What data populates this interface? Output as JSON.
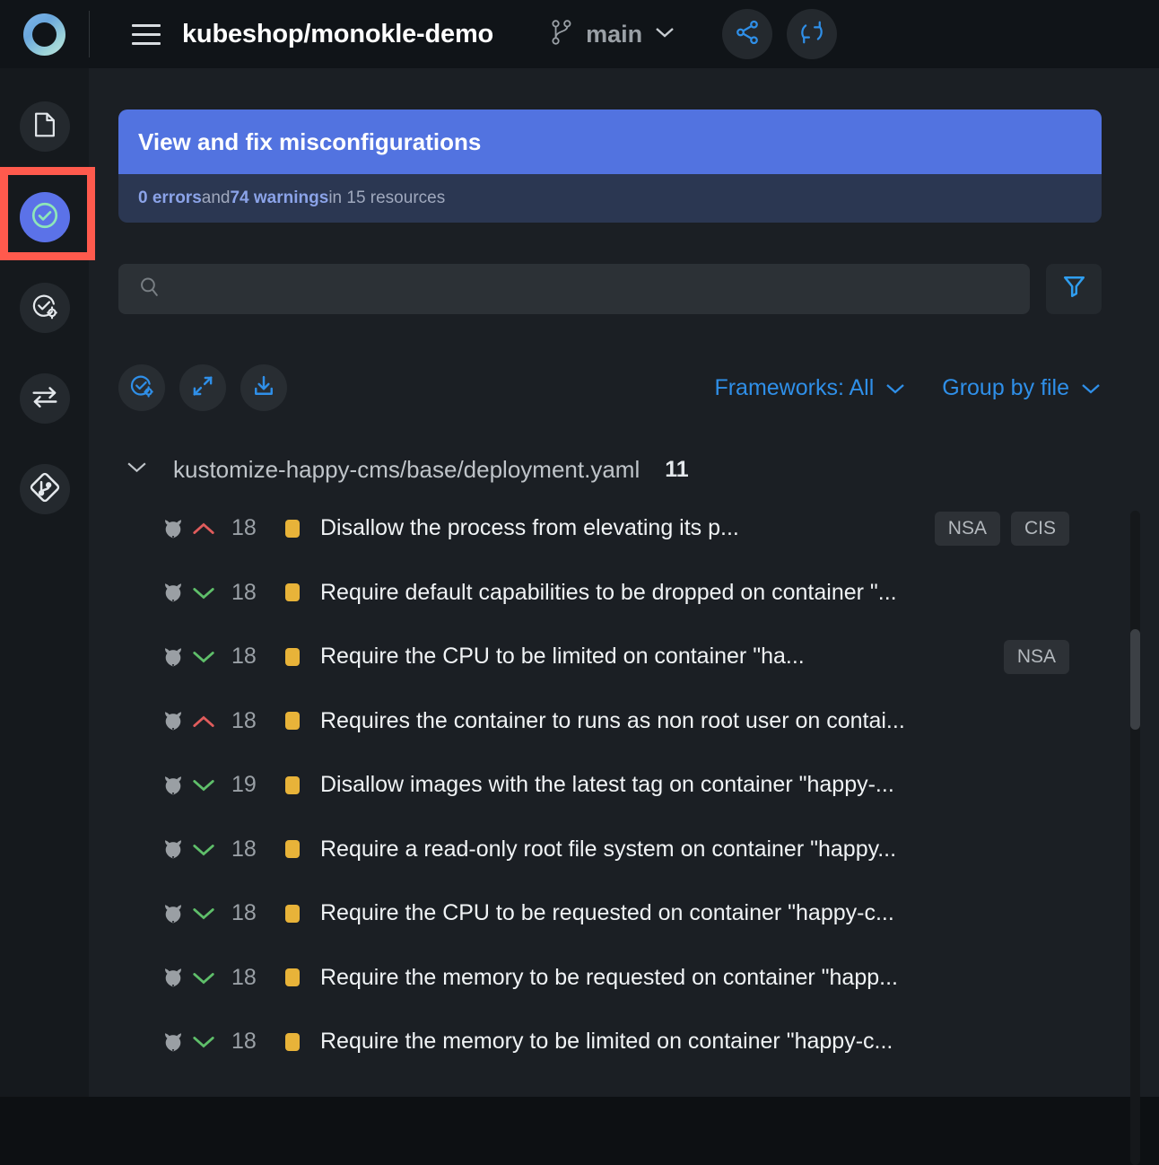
{
  "topbar": {
    "logo": "monokle-logo",
    "menu_icon": "hamburger-icon",
    "repo_title": "kubeshop/monokle-demo",
    "branch_icon": "git-branch-icon",
    "branch_name": "main",
    "branch_chevron": "chevron-down-icon",
    "share_icon": "share-icon",
    "sync_icon": "sync-refresh-icon"
  },
  "sidebar": {
    "items": [
      {
        "name": "file-explorer",
        "icon": "file-icon",
        "active": false
      },
      {
        "name": "validation",
        "icon": "check-circle-icon",
        "active": true
      },
      {
        "name": "validation-settings",
        "icon": "check-gear-icon",
        "active": false
      },
      {
        "name": "compare",
        "icon": "compare-arrows-icon",
        "active": false
      },
      {
        "name": "git",
        "icon": "git-diamond-icon",
        "active": false
      }
    ]
  },
  "banner": {
    "title": "View and fix misconfigurations",
    "errors_count": "0 errors",
    "and_text": " and ",
    "warnings_count": "74 warnings",
    "resources_text": " in 15 resources"
  },
  "search": {
    "value": "",
    "placeholder": "",
    "icon": "search-icon",
    "filter_icon": "filter-funnel-icon"
  },
  "toolbar": {
    "buttons": [
      {
        "name": "configure-validation",
        "icon": "check-gear-icon"
      },
      {
        "name": "collapse-all",
        "icon": "collapse-arrows-icon"
      },
      {
        "name": "download-report",
        "icon": "download-icon"
      }
    ],
    "frameworks_label": "Frameworks: All",
    "frameworks_chevron": "chevron-down-icon",
    "groupby_label": "Group by file",
    "groupby_chevron": "chevron-down-icon"
  },
  "list": {
    "group": {
      "chevron": "chevron-down-icon",
      "file": "kustomize-happy-cms/base/deployment.yaml",
      "count": "11"
    },
    "rows": [
      {
        "icon": "owl-icon",
        "severity": "high",
        "severity_icon": "chevron-up-icon",
        "score": "18",
        "status": "warning",
        "text": "Disallow the process from elevating its p...",
        "tags": [
          "NSA",
          "CIS"
        ]
      },
      {
        "icon": "owl-icon",
        "severity": "low",
        "severity_icon": "chevron-down-icon",
        "score": "18",
        "status": "warning",
        "text": "Require default capabilities to be dropped on container \"...",
        "tags": []
      },
      {
        "icon": "owl-icon",
        "severity": "low",
        "severity_icon": "chevron-down-icon",
        "score": "18",
        "status": "warning",
        "text": "Require the CPU to be limited on container \"ha...",
        "tags": [
          "NSA"
        ]
      },
      {
        "icon": "owl-icon",
        "severity": "high",
        "severity_icon": "chevron-up-icon",
        "score": "18",
        "status": "warning",
        "text": "Requires the container to runs as non root user on contai...",
        "tags": []
      },
      {
        "icon": "owl-icon",
        "severity": "low",
        "severity_icon": "chevron-down-icon",
        "score": "19",
        "status": "warning",
        "text": "Disallow images with the latest tag on container \"happy-...",
        "tags": []
      },
      {
        "icon": "owl-icon",
        "severity": "low",
        "severity_icon": "chevron-down-icon",
        "score": "18",
        "status": "warning",
        "text": "Require a read-only root file system on container \"happy...",
        "tags": []
      },
      {
        "icon": "owl-icon",
        "severity": "low",
        "severity_icon": "chevron-down-icon",
        "score": "18",
        "status": "warning",
        "text": "Require the CPU to be requested on container \"happy-c...",
        "tags": []
      },
      {
        "icon": "owl-icon",
        "severity": "low",
        "severity_icon": "chevron-down-icon",
        "score": "18",
        "status": "warning",
        "text": "Require the memory to be requested on container \"happ...",
        "tags": []
      },
      {
        "icon": "owl-icon",
        "severity": "low",
        "severity_icon": "chevron-down-icon",
        "score": "18",
        "status": "warning",
        "text": "Require the memory to be limited on container \"happy-c...",
        "tags": []
      }
    ]
  },
  "annotation": {
    "highlight_color": "#ff5a4d",
    "target": "sidebar-item-validation"
  },
  "colors": {
    "accent_blue": "#5273e0",
    "link_blue": "#2f8fe8",
    "warning_amber": "#e8b339",
    "severity_high": "#e05c5c",
    "severity_low": "#5fbf6a",
    "bg_main": "#1b1f24",
    "bg_rail": "#15191d",
    "bg_topbar": "#101418"
  }
}
